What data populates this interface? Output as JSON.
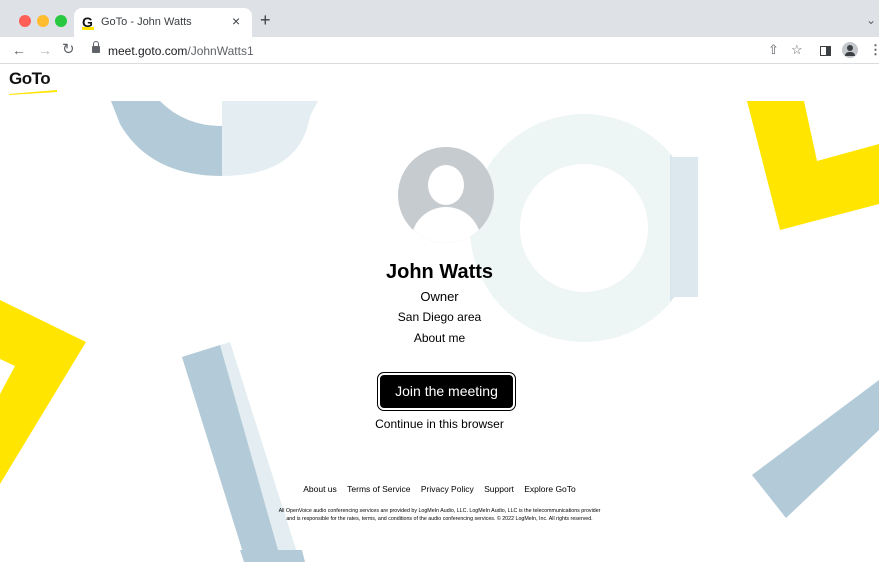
{
  "browser": {
    "tab_title": "GoTo - John Watts",
    "tab_close": "×",
    "new_tab": "+",
    "url_host": "meet.goto.com",
    "url_path": "/JohnWatts1",
    "favicon_letter": "G"
  },
  "page": {
    "logo": "GoTo",
    "brand_colors": {
      "yellow": "#ffe500",
      "blue": "#b3cbd8",
      "light_blue": "#e4edf1",
      "mint": "#eef5f5"
    },
    "profile": {
      "name": "John Watts",
      "role": "Owner",
      "location": "San Diego area",
      "about_link": "About me"
    },
    "join_button": "Join the meeting",
    "continue_link": "Continue in this browser",
    "footer": {
      "links": [
        "About us",
        "Terms of Service",
        "Privacy Policy",
        "Support",
        "Explore GoTo"
      ],
      "legal_line1": "All OpenVoice audio conferencing services are provided by LogMeIn Audio, LLC. LogMeIn Audio, LLC is the telecommunications provider",
      "legal_line2": "and is responsible for the rates, terms, and conditions of the audio conferencing services. © 2022 LogMeIn, Inc. All rights reserved."
    }
  }
}
